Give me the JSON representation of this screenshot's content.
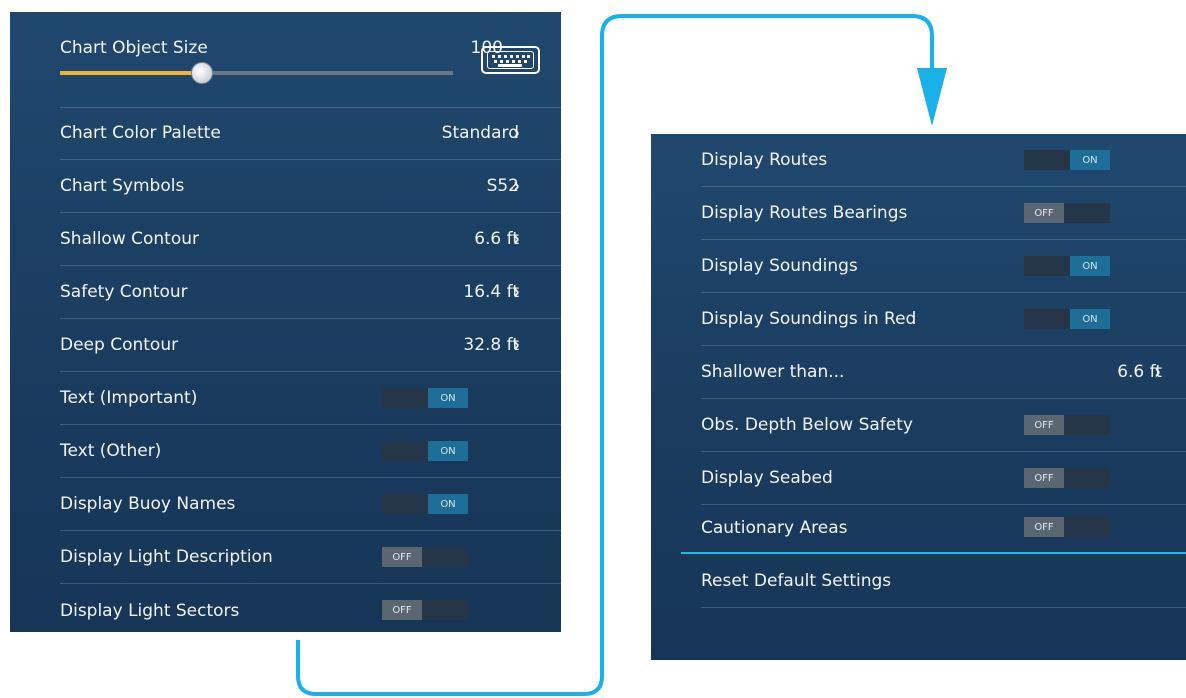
{
  "left_panel": {
    "slider": {
      "label": "Chart Object Size",
      "value": "100",
      "fraction": 0.36
    },
    "keyboard_icon": "keyboard-icon",
    "rows": [
      {
        "label": "Chart Color Palette",
        "value": "Standard",
        "chevron": "›"
      },
      {
        "label": "Chart Symbols",
        "value": "S52",
        "chevron": "›"
      },
      {
        "label": "Shallow Contour",
        "value": "6.6 ft",
        "chevron": "›"
      },
      {
        "label": "Safety Contour",
        "value": "16.4 ft",
        "chevron": "›"
      },
      {
        "label": "Deep Contour",
        "value": "32.8 ft",
        "chevron": "›"
      },
      {
        "label": "Text (Important)",
        "toggle": "ON"
      },
      {
        "label": "Text (Other)",
        "toggle": "ON"
      },
      {
        "label": "Display Buoy Names",
        "toggle": "ON"
      },
      {
        "label": "Display Light Description",
        "toggle": "OFF"
      },
      {
        "label": "Display Light Sectors",
        "toggle": "OFF"
      }
    ]
  },
  "right_panel": {
    "rows": [
      {
        "label": "Display Routes",
        "toggle": "ON"
      },
      {
        "label": "Display Routes Bearings",
        "toggle": "OFF"
      },
      {
        "label": "Display Soundings",
        "toggle": "ON"
      },
      {
        "label": "Display Soundings in Red",
        "toggle": "ON"
      },
      {
        "label": "Shallower than...",
        "value": "6.6 ft",
        "chevron": "›"
      },
      {
        "label": "Obs. Depth Below Safety",
        "toggle": "OFF"
      },
      {
        "label": "Display Seabed",
        "toggle": "OFF"
      },
      {
        "label": "Cautionary Areas",
        "toggle": "OFF"
      },
      {
        "label": "Reset Default Settings"
      }
    ]
  },
  "colors": {
    "panel_bg": "#1a3c5f",
    "accent_cyan": "#1ab0e8",
    "slider_fill": "#f2b233",
    "toggle_on": "#1f6e97",
    "toggle_off": "#5a6672"
  }
}
